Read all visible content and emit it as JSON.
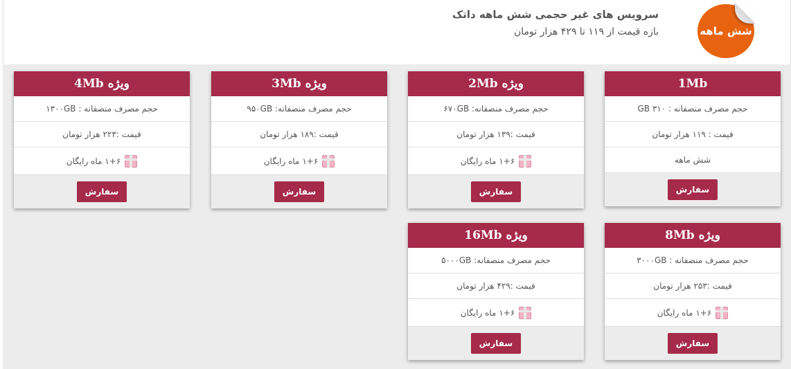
{
  "header": {
    "badge": "شش ماهه",
    "title": "سرویس های غیر حجمی شش ماهه داتک",
    "subtitle": "بازه قیمت از ۱۱۹ تا ۴۲۹ هزار تومان"
  },
  "order_label": "سفارش",
  "plans": [
    {
      "title": "1Mb",
      "usage": "حجم مصرف منصفانه : ۳۱۰ GB",
      "price": "قیمت : ۱۱۹ هزار تومان",
      "extra": "شش ماهه"
    },
    {
      "title": "ویژه 2Mb",
      "usage": "حجم مصرف منصفانه: ۶۷۰GB",
      "price": "قیمت :۱۳۹ هزار تومان",
      "extra": "۱+۶ ماه رایگان"
    },
    {
      "title": "ویژه 3Mb",
      "usage": "حجم مصرف منصفانه: ۹۵۰GB",
      "price": "قیمت :۱۸۹ هزار تومان",
      "extra": "۱+۶ ماه رایگان"
    },
    {
      "title": "ویژه 4Mb",
      "usage": "حجم مصرف منصفانه : ۱۳۰۰GB",
      "price": "قیمت :۲۲۳ هزار تومان",
      "extra": "۱+۶ ماه رایگان"
    },
    {
      "title": "ویژه 8Mb",
      "usage": "حجم مصرف منصفانه : ۳۰۰۰GB",
      "price": "قیمت :۲۵۳ هزار تومان",
      "extra": "۱+۶ ماه رایگان"
    },
    {
      "title": "ویژه 16Mb",
      "usage": "حجم مصرف منصفانه: ۵۰۰۰GB",
      "price": "قیمت :۴۲۹ هزار تومان",
      "extra": "۱+۶ ماه رایگان"
    }
  ]
}
